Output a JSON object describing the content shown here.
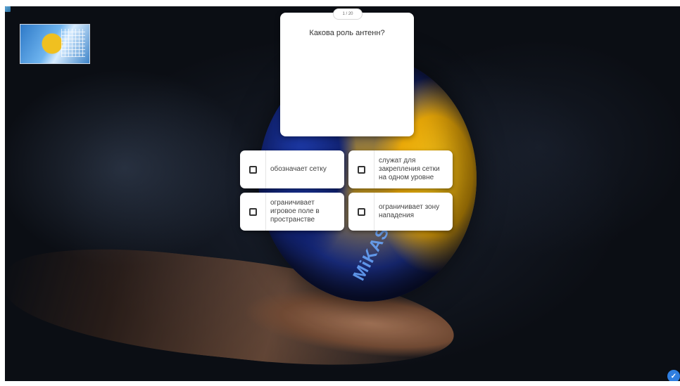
{
  "progress": {
    "counter": "1 / 20"
  },
  "question": {
    "text": "Какова роль антенн?"
  },
  "answers": [
    {
      "label": "обозначает сетку"
    },
    {
      "label": "служат для закрепления сетки на одном уровне"
    },
    {
      "label": "ограничивает игровое поле в пространстве"
    },
    {
      "label": "ограничивает зону нападения"
    }
  ],
  "background": {
    "brand_text": "MiKASA"
  },
  "icons": {
    "corner": "image-placeholder-icon",
    "submit": "check-circle-icon",
    "answer_checkbox": "checkbox-icon"
  },
  "colors": {
    "card": "#ffffff",
    "accent": "#2f7ee0",
    "ball_yellow": "#f3c21a",
    "ball_blue": "#1b2f86"
  }
}
